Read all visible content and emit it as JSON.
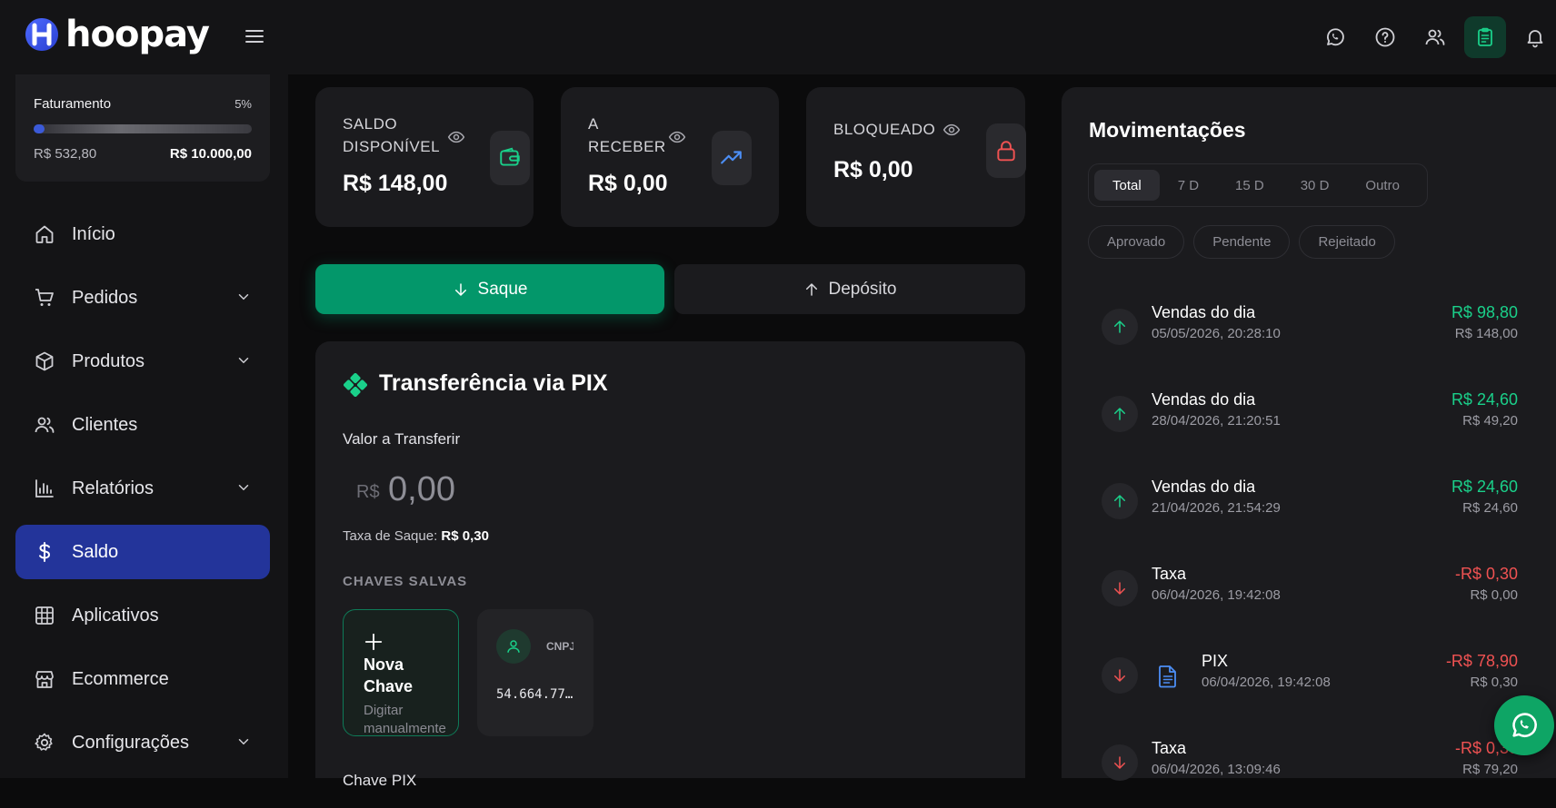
{
  "brand": {
    "name": "hoopay"
  },
  "billing": {
    "title": "Faturamento",
    "percent": "5%",
    "progress": 0.05,
    "current": "R$ 532,80",
    "goal": "R$ 10.000,00"
  },
  "nav": [
    {
      "label": "Início",
      "icon": "home-icon"
    },
    {
      "label": "Pedidos",
      "icon": "cart-icon"
    },
    {
      "label": "Produtos",
      "icon": "box-icon"
    },
    {
      "label": "Clientes",
      "icon": "users-icon"
    },
    {
      "label": "Relatórios",
      "icon": "chart-icon"
    },
    {
      "label": "Saldo",
      "icon": "dollar-icon",
      "active": true
    },
    {
      "label": "Aplicativos",
      "icon": "grid-icon"
    },
    {
      "label": "Ecommerce",
      "icon": "store-icon"
    },
    {
      "label": "Configurações",
      "icon": "gear-icon"
    }
  ],
  "stats": {
    "available": {
      "label_line1": "SALDO",
      "label_line2": "DISPONÍVEL",
      "value": "R$ 148,00"
    },
    "receivable": {
      "label_line1": "A",
      "label_line2": "RECEBER",
      "value": "R$ 0,00"
    },
    "blocked": {
      "label": "BLOQUEADO",
      "value": "R$ 0,00"
    }
  },
  "actions": {
    "withdraw": "Saque",
    "deposit": "Depósito"
  },
  "pix": {
    "title": "Transferência via PIX",
    "amount_label": "Valor a Transferir",
    "currency": "R$",
    "amount_placeholder": "0,00",
    "fee_label": "Taxa de Saque:",
    "fee_value": "R$ 0,30",
    "saved_keys_label": "CHAVES SALVAS",
    "new_key_line1": "Nova",
    "new_key_line2": "Chave",
    "new_key_hint": "Digitar manualmente",
    "saved_key_type": "CNPJ",
    "saved_key_value": "54.664.77…",
    "pix_key_label": "Chave PIX"
  },
  "movements": {
    "title": "Movimentações",
    "tabs": [
      "Total",
      "7 D",
      "15 D",
      "30 D",
      "Outro"
    ],
    "filters": [
      "Aprovado",
      "Pendente",
      "Rejeitado"
    ],
    "items": [
      {
        "name": "Vendas do dia",
        "date": "05/05/2026, 20:28:10",
        "amount": "R$ 98,80",
        "balance": "R$ 148,00",
        "dir": "in"
      },
      {
        "name": "Vendas do dia",
        "date": "28/04/2026, 21:20:51",
        "amount": "R$ 24,60",
        "balance": "R$ 49,20",
        "dir": "in"
      },
      {
        "name": "Vendas do dia",
        "date": "21/04/2026, 21:54:29",
        "amount": "R$ 24,60",
        "balance": "R$ 24,60",
        "dir": "in"
      },
      {
        "name": "Taxa",
        "date": "06/04/2026, 19:42:08",
        "amount": "-R$ 0,30",
        "balance": "R$ 0,00",
        "dir": "out"
      },
      {
        "name": "PIX",
        "date": "06/04/2026, 19:42:08",
        "amount": "-R$ 78,90",
        "balance": "R$ 0,30",
        "dir": "out",
        "doc": true
      },
      {
        "name": "Taxa",
        "date": "06/04/2026, 13:09:46",
        "amount": "-R$ 0,30",
        "balance": "R$ 79,20",
        "dir": "out"
      }
    ]
  },
  "colors": {
    "accent": "#03976a",
    "active_nav": "#23349a",
    "positive": "#1ad08a",
    "negative": "#f05252"
  }
}
